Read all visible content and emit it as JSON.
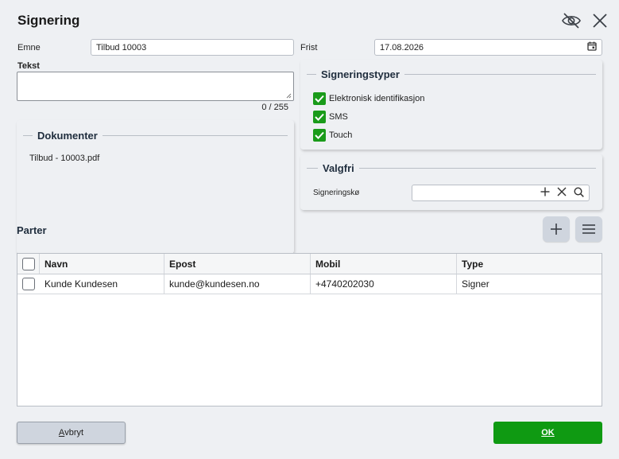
{
  "dialog": {
    "title": "Signering"
  },
  "form": {
    "subject_label": "Emne",
    "subject_value": "Tilbud 10003",
    "deadline_label": "Frist",
    "deadline_value": "17.08.2026",
    "text_label": "Tekst",
    "text_value": "",
    "char_counter": "0 / 255"
  },
  "documents": {
    "legend": "Dokumenter",
    "items": [
      "Tilbud - 10003.pdf"
    ]
  },
  "signing_types": {
    "legend": "Signeringstyper",
    "options": [
      {
        "label": "Elektronisk identifikasjon",
        "checked": true
      },
      {
        "label": "SMS",
        "checked": true
      },
      {
        "label": "Touch",
        "checked": true
      }
    ]
  },
  "optional": {
    "legend": "Valgfri",
    "queue_label": "Signeringskø",
    "queue_value": ""
  },
  "parties": {
    "title": "Parter",
    "columns": [
      "Navn",
      "Epost",
      "Mobil",
      "Type"
    ],
    "rows": [
      {
        "name": "Kunde Kundesen",
        "email": "kunde@kundesen.no",
        "mobile": "+4740202030",
        "type": "Signer",
        "checked": false
      }
    ]
  },
  "footer": {
    "cancel_label_first": "A",
    "cancel_label_rest": "vbryt",
    "ok_label": "OK"
  },
  "colors": {
    "ok_button": "#0f9a12",
    "checkbox_checked": "#1a9b1a",
    "background": "#eef0f3"
  }
}
